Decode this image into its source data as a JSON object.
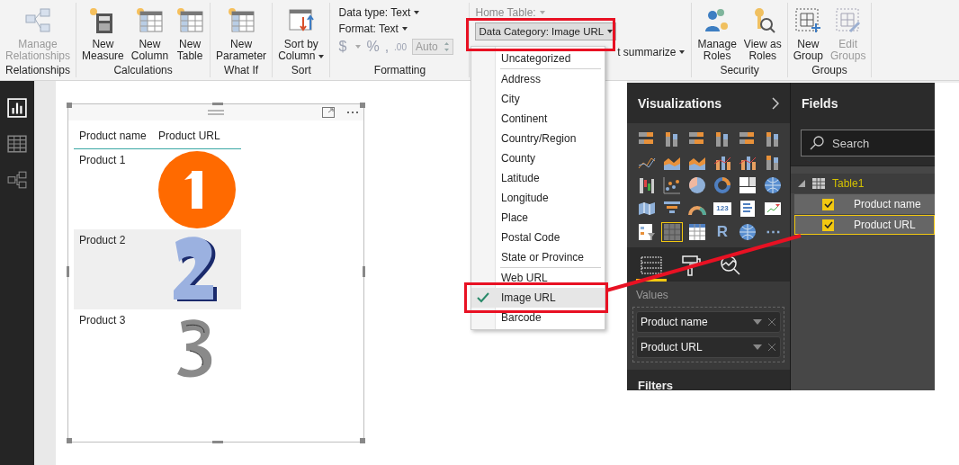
{
  "ribbon": {
    "groups": [
      {
        "label": "Relationships",
        "buttons": [
          {
            "lines": [
              "Manage",
              "Relationships"
            ],
            "kind": "relationships",
            "disabled": true
          }
        ]
      },
      {
        "label": "Calculations",
        "buttons": [
          {
            "lines": [
              "New",
              "Measure"
            ],
            "kind": "measure",
            "disabled": false
          },
          {
            "lines": [
              "New",
              "Column"
            ],
            "kind": "column",
            "disabled": false
          },
          {
            "lines": [
              "New",
              "Table"
            ],
            "kind": "table",
            "disabled": false
          }
        ]
      },
      {
        "label": "What If",
        "buttons": [
          {
            "lines": [
              "New",
              "Parameter"
            ],
            "kind": "parameter",
            "disabled": false
          }
        ]
      },
      {
        "label": "Sort",
        "buttons": [
          {
            "lines": [
              "Sort by",
              "Column"
            ],
            "kind": "sort",
            "disabled": false,
            "has_menu": true
          }
        ]
      }
    ],
    "formatting": {
      "label": "Formatting",
      "data_type": "Data type: Text",
      "format": "Format: Text",
      "currency": "$",
      "percent": "%",
      "comma": ",",
      "decimals": ".00",
      "auto": "Auto"
    },
    "properties": {
      "home_table": "Home Table:",
      "data_category": "Data Category: Image URL",
      "summarize": "t summarize"
    },
    "groups_right": [
      {
        "label": "Security",
        "buttons": [
          {
            "lines": [
              "Manage",
              "Roles"
            ],
            "kind": "roles",
            "disabled": false
          },
          {
            "lines": [
              "View as",
              "Roles"
            ],
            "kind": "view-roles",
            "disabled": false
          }
        ]
      },
      {
        "label": "Groups",
        "buttons": [
          {
            "lines": [
              "New",
              "Group"
            ],
            "kind": "new-group",
            "disabled": false
          },
          {
            "lines": [
              "Edit",
              "Groups"
            ],
            "kind": "edit-groups",
            "disabled": true
          }
        ]
      }
    ]
  },
  "views": [
    {
      "kind": "report",
      "selected": true
    },
    {
      "kind": "data",
      "selected": false
    },
    {
      "kind": "model",
      "selected": false
    }
  ],
  "table_visual": {
    "columns": [
      "Product name",
      "Product URL"
    ],
    "rows": [
      {
        "name": "Product 1",
        "highlighted": false
      },
      {
        "name": "Product 2",
        "highlighted": true
      },
      {
        "name": "Product 3",
        "highlighted": false
      }
    ]
  },
  "category_menu": {
    "sections": [
      [
        {
          "label": "Uncategorized",
          "selected": false
        }
      ],
      [
        {
          "label": "Address",
          "selected": false
        },
        {
          "label": "City",
          "selected": false
        },
        {
          "label": "Continent",
          "selected": false
        },
        {
          "label": "Country/Region",
          "selected": false
        },
        {
          "label": "County",
          "selected": false
        },
        {
          "label": "Latitude",
          "selected": false
        },
        {
          "label": "Longitude",
          "selected": false
        },
        {
          "label": "Place",
          "selected": false
        },
        {
          "label": "Postal Code",
          "selected": false
        },
        {
          "label": "State or Province",
          "selected": false
        }
      ],
      [
        {
          "label": "Web URL",
          "selected": false
        },
        {
          "label": "Image URL",
          "selected": true
        },
        {
          "label": "Barcode",
          "selected": false
        }
      ]
    ]
  },
  "visualizations": {
    "title": "Visualizations",
    "types": [
      {
        "kind": "bar",
        "selected": false
      },
      {
        "kind": "column",
        "selected": false
      },
      {
        "kind": "bar",
        "selected": false
      },
      {
        "kind": "column",
        "selected": false
      },
      {
        "kind": "bar",
        "selected": false
      },
      {
        "kind": "column",
        "selected": false
      },
      {
        "kind": "line",
        "selected": false
      },
      {
        "kind": "area",
        "selected": false
      },
      {
        "kind": "area",
        "selected": false
      },
      {
        "kind": "combo",
        "selected": false
      },
      {
        "kind": "combo",
        "selected": false
      },
      {
        "kind": "column",
        "selected": false
      },
      {
        "kind": "waterfall",
        "selected": false
      },
      {
        "kind": "scatter",
        "selected": false
      },
      {
        "kind": "pie",
        "selected": false
      },
      {
        "kind": "donut",
        "selected": false
      },
      {
        "kind": "treemap",
        "selected": false
      },
      {
        "kind": "globe",
        "selected": false
      },
      {
        "kind": "map",
        "selected": false
      },
      {
        "kind": "funnel",
        "selected": false
      },
      {
        "kind": "gauge",
        "selected": false
      },
      {
        "kind": "card",
        "selected": false,
        "label": "123"
      },
      {
        "kind": "multirow",
        "selected": false
      },
      {
        "kind": "kpi",
        "selected": false
      },
      {
        "kind": "slicer",
        "selected": false
      },
      {
        "kind": "table",
        "selected": true
      },
      {
        "kind": "matrix",
        "selected": false
      },
      {
        "kind": "text",
        "selected": false,
        "label": "R"
      },
      {
        "kind": "globe",
        "selected": false
      },
      {
        "kind": "text",
        "selected": false,
        "label": "⋯"
      }
    ],
    "tabs": [
      {
        "kind": "fields",
        "selected": true
      },
      {
        "kind": "format",
        "selected": false
      },
      {
        "kind": "analytics",
        "selected": false
      }
    ],
    "values_label": "Values",
    "wells": [
      "Product name",
      "Product URL"
    ],
    "filters_label": "Filters"
  },
  "fields": {
    "title": "Fields",
    "search": {
      "placeholder": "Search"
    },
    "tables": [
      {
        "name": "Table1",
        "expanded": true,
        "children": [
          {
            "name": "Product name",
            "checked": true,
            "selected": false
          },
          {
            "name": "Product URL",
            "checked": true,
            "selected": true
          }
        ]
      }
    ]
  }
}
